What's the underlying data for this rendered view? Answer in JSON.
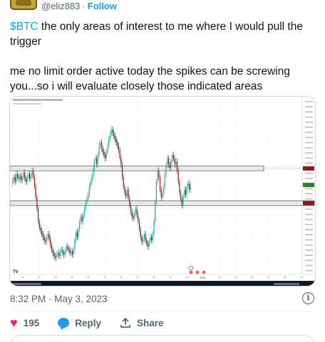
{
  "tweet": {
    "handle": "@eliz883",
    "separator": "·",
    "follow_label": "Follow",
    "cashtag": "$BTC",
    "text_line1_rest": " the only areas of interest to me where I would pull the trigger",
    "text_para2": "me no limit order active today the spikes can be screwing you...so i will evaluate closely those indicated areas",
    "timestamp": "8:32 PM · May 3, 2023",
    "likes_count": "195",
    "reply_label": "Reply",
    "share_label": "Share"
  },
  "chart_data": {
    "type": "candlestick",
    "title": "",
    "xlabel": "",
    "ylabel": "",
    "grid": true,
    "x_tick_labels": [
      "",
      "",
      "",
      "",
      "",
      "",
      "",
      "",
      "",
      "",
      "",
      "May",
      "",
      "",
      "",
      "",
      "",
      ""
    ],
    "price_path": [
      0.54,
      0.56,
      0.58,
      0.55,
      0.6,
      0.58,
      0.57,
      0.59,
      0.56,
      0.58,
      0.61,
      0.57,
      0.55,
      0.58,
      0.6,
      0.57,
      0.59,
      0.62,
      0.58,
      0.52,
      0.45,
      0.38,
      0.3,
      0.26,
      0.24,
      0.22,
      0.2,
      0.18,
      0.17,
      0.2,
      0.22,
      0.19,
      0.15,
      0.12,
      0.1,
      0.08,
      0.07,
      0.09,
      0.1,
      0.08,
      0.11,
      0.12,
      0.1,
      0.09,
      0.11,
      0.14,
      0.13,
      0.12,
      0.1,
      0.11,
      0.09,
      0.12,
      0.18,
      0.23,
      0.2,
      0.25,
      0.3,
      0.33,
      0.3,
      0.34,
      0.38,
      0.42,
      0.44,
      0.47,
      0.52,
      0.55,
      0.58,
      0.62,
      0.68,
      0.7,
      0.66,
      0.72,
      0.78,
      0.8,
      0.76,
      0.74,
      0.72,
      0.7,
      0.74,
      0.78,
      0.82,
      0.85,
      0.88,
      0.86,
      0.84,
      0.82,
      0.8,
      0.78,
      0.75,
      0.7,
      0.66,
      0.58,
      0.52,
      0.48,
      0.46,
      0.5,
      0.45,
      0.4,
      0.36,
      0.33,
      0.32,
      0.35,
      0.38,
      0.34,
      0.3,
      0.25,
      0.2,
      0.17,
      0.19,
      0.22,
      0.18,
      0.16,
      0.14,
      0.17,
      0.2,
      0.18,
      0.22,
      0.3,
      0.42,
      0.55,
      0.62,
      0.58,
      0.5,
      0.45,
      0.48,
      0.52,
      0.6,
      0.66,
      0.7,
      0.66,
      0.64,
      0.68,
      0.72,
      0.7,
      0.66,
      0.68,
      0.62,
      0.55,
      0.48,
      0.44,
      0.4,
      0.46,
      0.5,
      0.47,
      0.52,
      0.54,
      0.5,
      0.53
    ],
    "resistance_zone": [
      0.62,
      0.65
    ],
    "support_zone": [
      0.4,
      0.43
    ]
  },
  "colors": {
    "accent": "#1d9bf0",
    "like": "#f91880",
    "muted": "#536471",
    "zone_fill": "#e9e9e9",
    "zone_border": "#555555",
    "candle_up": "#26a69a",
    "candle_down": "#8b1a1a",
    "candle_neutral": "#222222"
  },
  "icons": {
    "info": "info-icon",
    "heart": "heart-icon",
    "reply": "reply-icon",
    "share": "share-icon"
  }
}
